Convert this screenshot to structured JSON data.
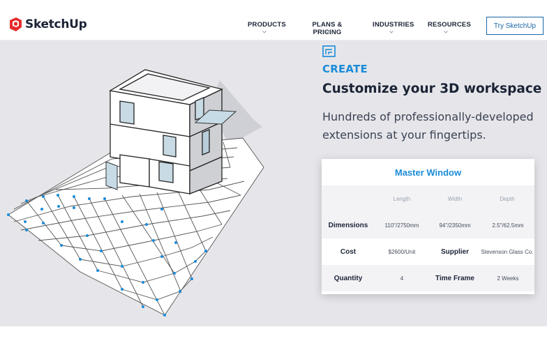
{
  "brand": {
    "name": "SketchUp",
    "logo_color": "#e72b2d"
  },
  "nav": {
    "items": [
      {
        "label": "PRODUCTS"
      },
      {
        "label": "PLANS & PRICING"
      },
      {
        "label": "INDUSTRIES"
      },
      {
        "label": "RESOURCES"
      }
    ],
    "cta_label": "Try SketchUp"
  },
  "hero": {
    "section_label": "CREATE",
    "headline": "Customize your 3D workspace",
    "subline": "Hundreds of professionally-developed extensions at your fingertips.",
    "accent_color": "#1a8bd8",
    "background_color": "#e6e6ea"
  },
  "card": {
    "title": "Master Window",
    "column_headers": [
      "Length",
      "Width",
      "Depth"
    ],
    "dimensions": {
      "label": "Dimensions",
      "length": "110\"/2750mm",
      "width": "94\"/2350mm",
      "depth": "2.5\"/62.5mm"
    },
    "cost": {
      "label": "Cost",
      "value": "$2600/Unit",
      "supplier_label": "Supplier",
      "supplier_value": "Stevenson Glass Co."
    },
    "quantity": {
      "label": "Quantity",
      "value": "4",
      "timeframe_label": "Time Frame",
      "timeframe_value": "2 Weeks"
    }
  },
  "icons": {
    "logo": "sketchup-logo-icon",
    "section": "create-section-icon",
    "nav_chevron": "chevron-down-icon"
  }
}
